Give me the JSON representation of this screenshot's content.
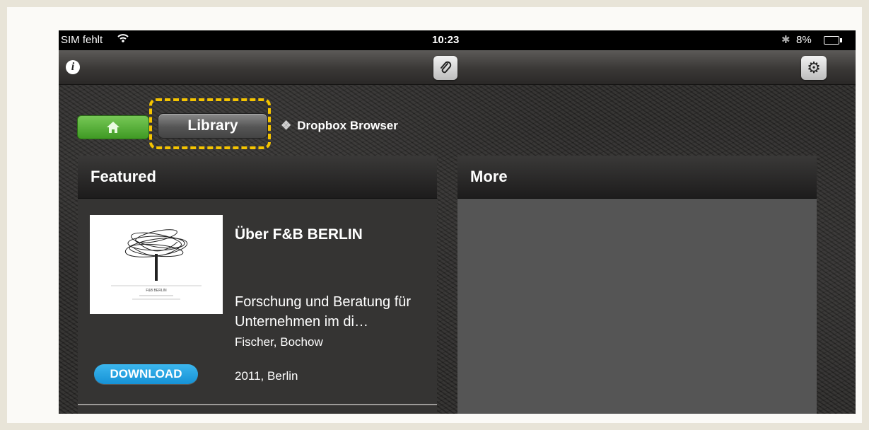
{
  "status_bar": {
    "carrier": "SIM fehlt",
    "time": "10:23",
    "battery": "8%"
  },
  "toolbar": {
    "info_glyph": "i",
    "attach_icon": "paperclip-icon",
    "settings_icon": "gear-icon"
  },
  "breadcrumb": {
    "home_icon": "home-icon",
    "library_label": "Library",
    "dropbox_label": "Dropbox Browser"
  },
  "featured": {
    "header": "Featured",
    "book": {
      "title": "Über F&B BERLIN",
      "description": "Forschung und Beratung für Unternehmen im di…",
      "authors": "Fischer, Bochow",
      "meta": "2011, Berlin",
      "cover_caption": "F&B BERLIN"
    },
    "download_label": "DOWNLOAD"
  },
  "more": {
    "header": "More"
  },
  "colors": {
    "highlight": "#f5c400",
    "home_green": "#4fab2e",
    "download_blue": "#1f9ee0"
  }
}
